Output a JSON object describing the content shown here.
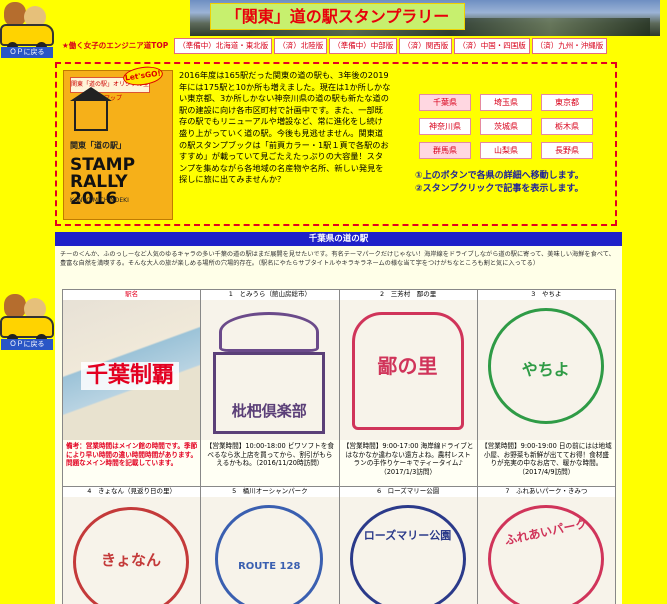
{
  "header": {
    "title": "「関東」道の駅スタンプラリー",
    "mascot_tag": "ＯＰに戻る"
  },
  "nav": [
    "★働く女子のエンジニア道TOP",
    "（準備中）北海道・東北版",
    "（済）北陸版",
    "（準備中）中部版",
    "（済）関西版",
    "（済）中国・四国版",
    "（済）九州・沖縄版"
  ],
  "intro": {
    "book": {
      "top_label": "関東「道の駅」オリジナル全体マップ",
      "badge": "Let'sGO!",
      "subtitle": "関東「道の駅」",
      "title": "STAMP RALLY",
      "year": "2016",
      "footer": "KANTO MICHINOEKI"
    },
    "text": "2016年度は165駅だった関東の道の駅も、3年後の2019年には175駅と10か所も増えました。現在は1か所しかない東京都、3か所しかない神奈川県の道の駅も新たな道の駅の建設に向け各市区町村で計画中です。また、一部既存の駅でもリニューアルや増設など、常に進化をし続け盛り上がっていく道の駅。今後も見逃せません。関東道の駅スタンプブックは「前頁カラー・1駅１頁で各駅のおすすめ」が載っていて見ごたえたっぷりの大容量！スタンプを集めながら各地域の名産物や名所、新しい発見を探しに旅に出てみませんか？",
    "prefs": [
      "千葉県",
      "埼玉県",
      "東京都",
      "神奈川県",
      "茨城県",
      "栃木県",
      "群馬県",
      "山梨県",
      "長野県"
    ],
    "notes": [
      "①上のボタンで各県の詳細へ移動します。",
      "②スタンプクリックで記事を表示します。"
    ]
  },
  "section": {
    "title": "千葉県の道の駅",
    "desc": "チーの＜んか、ふのっしーなど人気のゆるキャラの多い千葉の道の駅はまだ展開を見せたいです。有名テーマパークだけじゃない！海岸線をドライブしながら道の駅に寄って、美味しい海鮮を食べて、豊富な自然を満喫する。そんな大人の旅が楽しめる場所の穴場的存在。（駅名にやたらサブタイトルやキラキラネームの様な当て字をつけがちなところも割と気に入ってる）",
    "rows": [
      [
        {
          "num": "",
          "name": "駅名",
          "caption": "備考：営業時間はメイン館の時間です。季節により早い時間の違い時間時間があります。問題なメイン時間を記載しています。",
          "img": "千葉制覇"
        },
        {
          "num": "1",
          "name": "とみうら（館山房総市）",
          "caption": "【営業時間】10:00-18:00 ビワソフトを食べるなら氷上店を買ってから、割引がもらえるかもね。（2016/11/20時訪問）",
          "img": "枇杷倶楽部"
        },
        {
          "num": "2",
          "name": "三芳村　鄙の里",
          "caption": "【営業時間】9:00-17:00 海岸線ドライブとはなかなか違わない遠方よね。農村レストランの手作りケーキでティータイム♪（2017/1/3訪問）",
          "img": "鄙の里"
        },
        {
          "num": "3",
          "name": "やちよ",
          "caption": "【営業時間】9:00-19:00 日の前にはは地域小屋、お野菜も新鮮が出ててお得！食材盛りが充実の中なお店で、暖かな時間。（2017/4/9訪問）",
          "img": "やちよ"
        }
      ],
      [
        {
          "num": "4",
          "name": "きょなん（見返り日の里）",
          "img": "きょなん"
        },
        {
          "num": "5",
          "name": "桶川オーシャンパーク",
          "img": "ROUTE 128"
        },
        {
          "num": "6",
          "name": "ローズマリー公園",
          "img": "ローズマリー公園"
        },
        {
          "num": "7",
          "name": "ふれあいパーク・きみつ",
          "img": "ふれあいパーク"
        }
      ]
    ]
  },
  "colors": {
    "background": "#ffff00",
    "accent_red": "#e30020",
    "section_blue": "#1f21c9",
    "note_blue": "#1b1f9c"
  }
}
